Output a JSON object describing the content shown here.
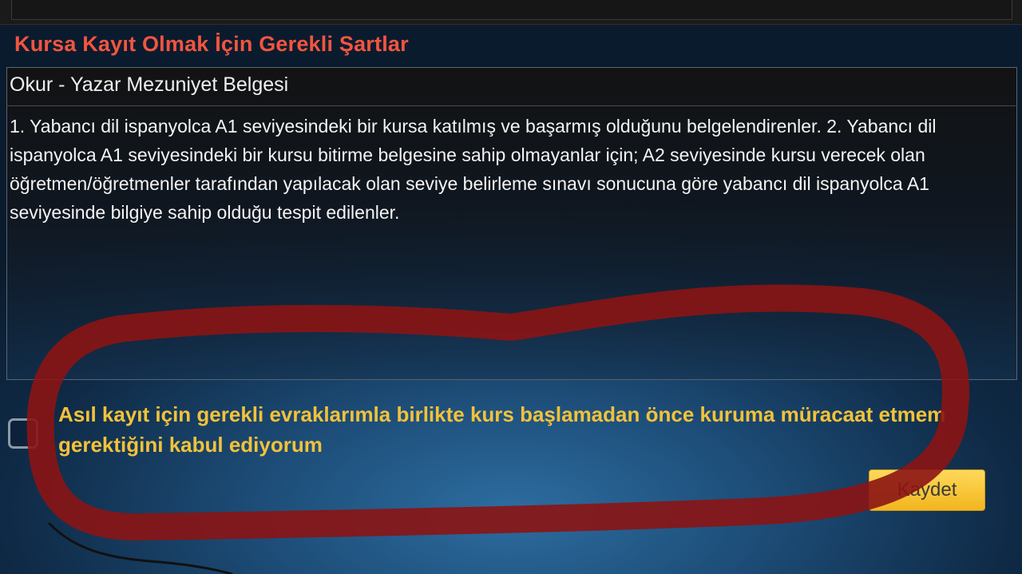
{
  "section_title": "Kursa Kayıt Olmak İçin Gerekli Şartlar",
  "document_name": "Okur - Yazar Mezuniyet Belgesi",
  "requirement_text": "1. Yabancı dil ispanyolca A1 seviyesindeki bir kursa katılmış ve başarmış olduğunu belgelendirenler. 2. Yabancı dil ispanyolca A1 seviyesindeki bir kursu bitirme belgesine sahip olmayanlar için; A2 seviyesinde kursu verecek olan öğretmen/öğretmenler tarafından yapılacak olan seviye belirleme sınavı sonucuna göre yabancı dil ispanyolca A1 seviyesinde bilgiye sahip olduğu tespit edilenler.",
  "acceptance": {
    "label": "Asıl kayıt için gerekli evraklarımla birlikte kurs başlamadan önce kuruma müracaat etmem gerektiğini kabul ediyorum",
    "checked": false
  },
  "save_button_label": "Kaydet",
  "colors": {
    "title": "#f2553f",
    "acceptance_text": "#f2c23a",
    "button": "#f5bf2a",
    "annotation_marker": "#8b1414"
  }
}
